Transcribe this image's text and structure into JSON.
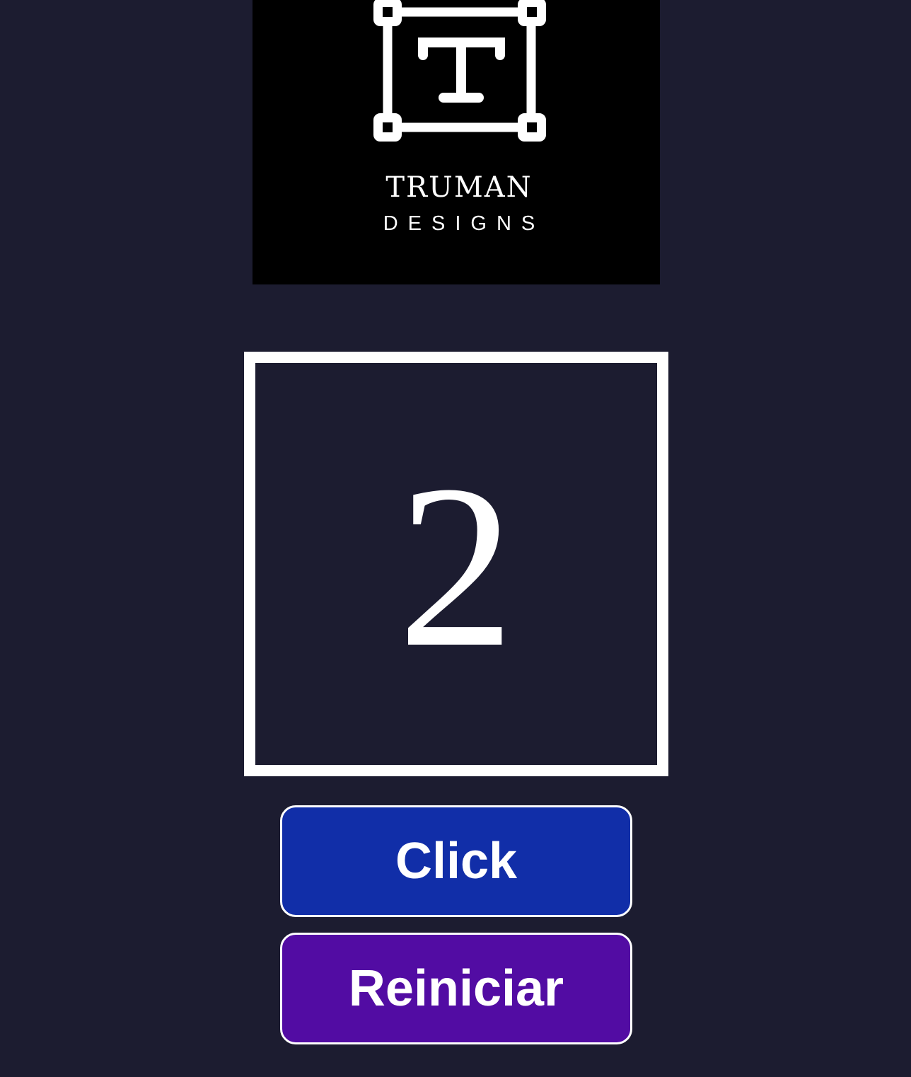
{
  "logo": {
    "name": "TRUMAN",
    "tagline": "DESIGNS"
  },
  "counter": {
    "value": "2"
  },
  "buttons": {
    "click_label": "Click",
    "reset_label": "Reiniciar"
  },
  "colors": {
    "background": "#1c1c30",
    "logo_background": "#000000",
    "click_button": "#112ea8",
    "reset_button": "#520ca3",
    "foreground": "#ffffff"
  }
}
